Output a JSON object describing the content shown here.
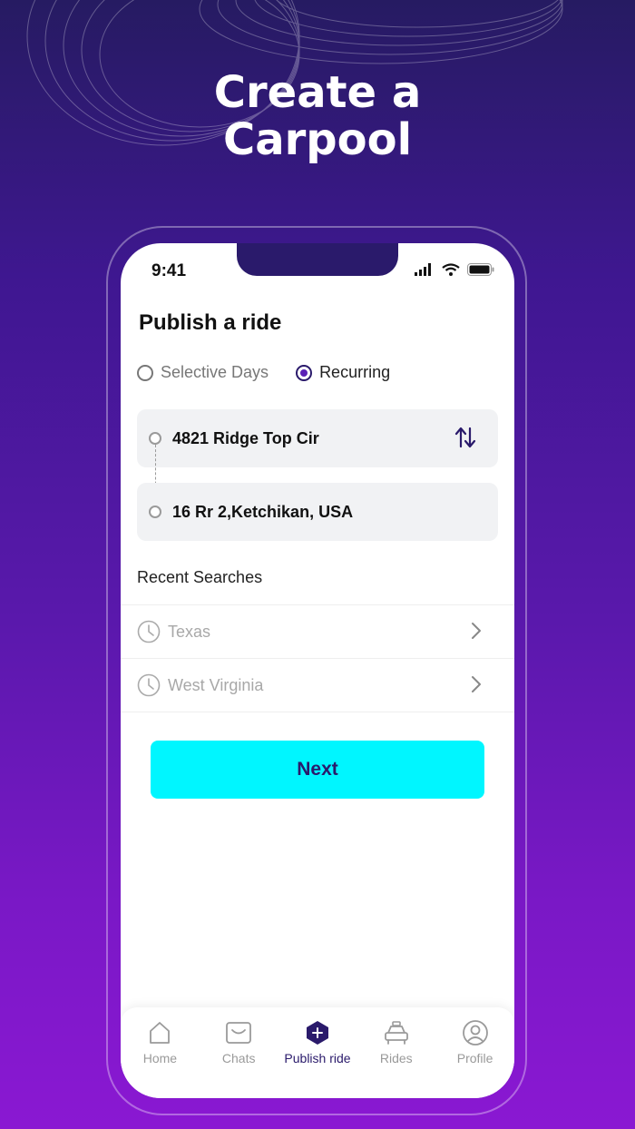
{
  "headline": {
    "line1": "Create a",
    "line2": "Carpool"
  },
  "status_bar": {
    "time": "9:41"
  },
  "page": {
    "title": "Publish a ride"
  },
  "ride_type": {
    "options": [
      {
        "label": "Selective Days",
        "selected": false
      },
      {
        "label": "Recurring",
        "selected": true
      }
    ]
  },
  "locations": {
    "from": "4821 Ridge Top Cir",
    "to": "16 Rr 2,Ketchikan, USA"
  },
  "recent": {
    "heading": "Recent Searches",
    "items": [
      {
        "label": "Texas"
      },
      {
        "label": "West Virginia"
      }
    ]
  },
  "next_button": {
    "label": "Next"
  },
  "tabbar": {
    "tabs": [
      {
        "label": "Home",
        "icon": "home-icon"
      },
      {
        "label": "Chats",
        "icon": "chat-icon"
      },
      {
        "label": "Publish ride",
        "icon": "plus-hexagon-icon",
        "active": true
      },
      {
        "label": "Rides",
        "icon": "car-icon"
      },
      {
        "label": "Profile",
        "icon": "user-icon"
      }
    ]
  },
  "colors": {
    "brand_dark": "#2a1a6b",
    "accent": "#00f6ff",
    "radio_selected": "#5b21b6"
  }
}
